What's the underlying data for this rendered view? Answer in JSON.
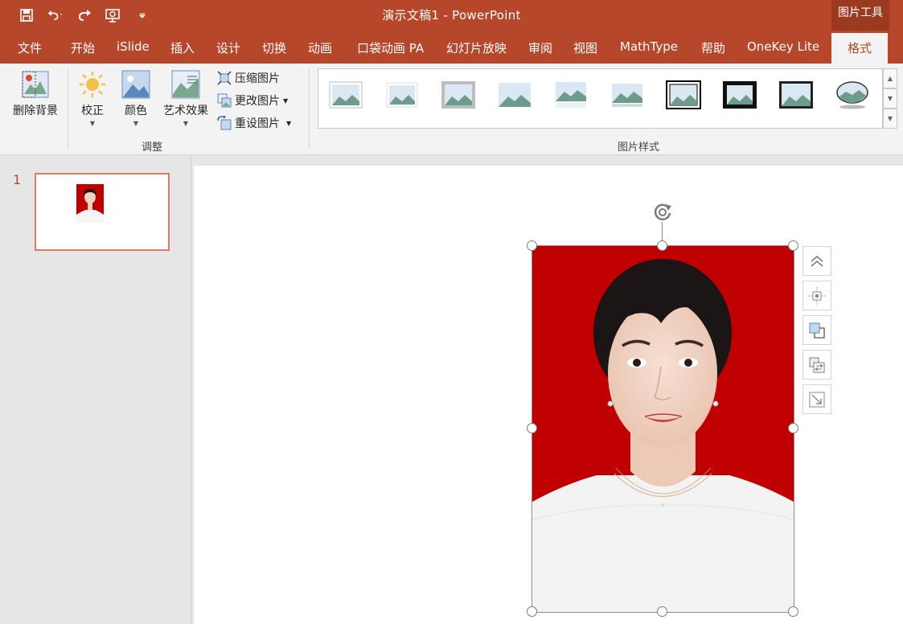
{
  "window": {
    "title": "演示文稿1  -  PowerPoint",
    "context_tab": "图片工具"
  },
  "menu": {
    "tabs": [
      "文件",
      "开始",
      "iSlide",
      "插入",
      "设计",
      "切换",
      "动画",
      "口袋动画 PA",
      "幻灯片放映",
      "审阅",
      "视图",
      "MathType",
      "帮助",
      "OneKey Lite",
      "格式"
    ],
    "active": "格式"
  },
  "ribbon": {
    "remove_bg": "删除背景",
    "corrections": "校正",
    "color": "颜色",
    "art_effects": "艺术效果",
    "compress": "压缩图片",
    "change": "更改图片",
    "reset": "重设图片",
    "group_adjust": "调整",
    "group_styles": "图片样式"
  },
  "slides": {
    "current_number": "1"
  },
  "colors": {
    "accent": "#b7472a",
    "photo_bg": "#c00000"
  }
}
